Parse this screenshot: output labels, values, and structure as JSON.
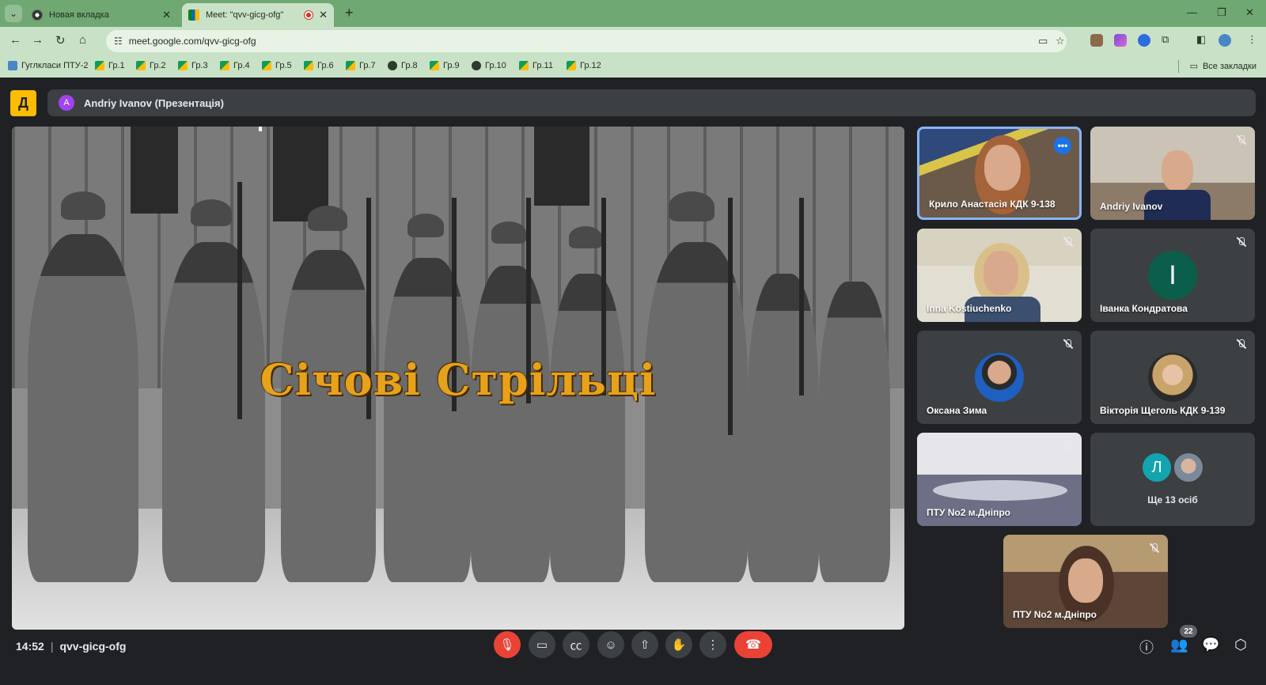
{
  "browser": {
    "tabs": [
      {
        "title": "Новая вкладка"
      },
      {
        "title": "Meet: \"qvv-gicg-ofg\""
      }
    ],
    "url": "meet.google.com/qvv-gicg-ofg",
    "bookmarks": [
      "Гуглкласи ПТУ-2",
      "Гр.1",
      "Гр.2",
      "Гр.3",
      "Гр.4",
      "Гр.5",
      "Гр.6",
      "Гр.7",
      "Гр.8",
      "Гр.9",
      "Гр.10",
      "Гр.11",
      "Гр.12"
    ],
    "all_bookmarks": "Все закладки"
  },
  "meet": {
    "presenter_initial": "A",
    "presenter_label": "Andriy Ivanov (Презентація)",
    "slide_title": "Січові Стрільці",
    "participants": [
      {
        "name": "Крило Анастасія КДК 9-138"
      },
      {
        "name": "Andriy Ivanov"
      },
      {
        "name": "Inna Kostiuchenko"
      },
      {
        "name": "Іванка Кондратова",
        "initial": "І"
      },
      {
        "name": "Оксана Зима"
      },
      {
        "name": "Вікторія Щеголь КДК 9-139"
      },
      {
        "name": "ПТУ No2 м.Дніпро"
      },
      {
        "name": "ПТУ No2 м.Дніпро"
      }
    ],
    "more_initial": "Л",
    "more_label": "Ще 13 осіб",
    "time": "14:52",
    "meeting_code": "qvv-gicg-ofg",
    "people_count": "22"
  },
  "colors": {
    "accent": "#8ab4f8",
    "danger": "#ea4335",
    "browser_frame": "#6fa872"
  }
}
